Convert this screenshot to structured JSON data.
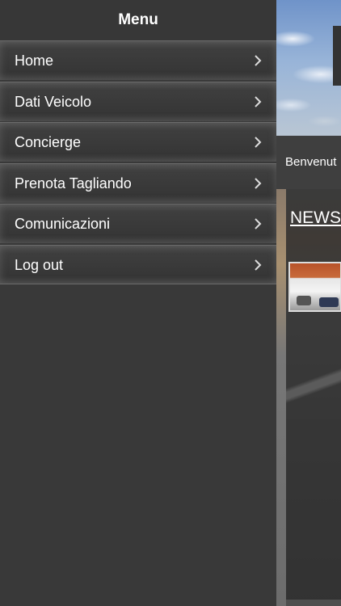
{
  "menu": {
    "title": "Menu",
    "items": [
      {
        "label": "Home",
        "icon": "chevron-right-icon"
      },
      {
        "label": "Dati Veicolo",
        "icon": "chevron-right-icon"
      },
      {
        "label": "Concierge",
        "icon": "chevron-right-icon"
      },
      {
        "label": "Prenota Tagliando",
        "icon": "chevron-right-icon"
      },
      {
        "label": "Comunicazioni",
        "icon": "chevron-right-icon"
      },
      {
        "label": "Log out",
        "icon": "chevron-right-icon"
      }
    ]
  },
  "page": {
    "welcome_text": "Benvenut",
    "news_title": "NEWS"
  },
  "colors": {
    "menu_background": "#393939",
    "menu_text": "#ffffff",
    "chevron": "#dddddd"
  }
}
